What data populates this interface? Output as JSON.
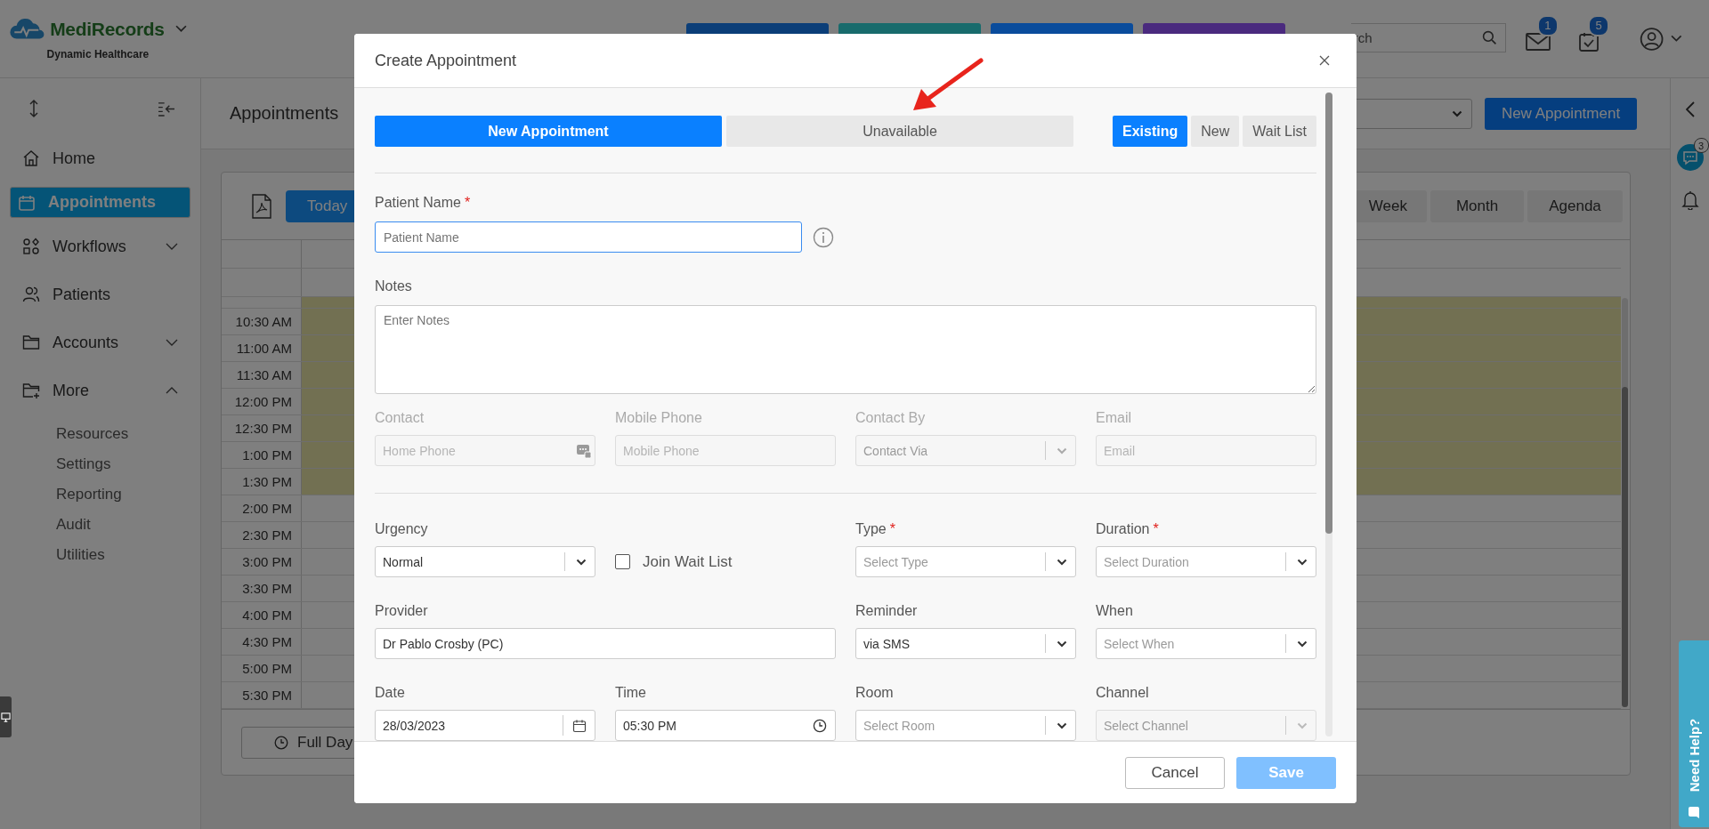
{
  "header": {
    "brand": "MediRecords",
    "tagline": "Dynamic Healthcare",
    "quick_buttons": [
      {
        "color": "#0b3e78"
      },
      {
        "color": "#186b6c"
      },
      {
        "color": "#0a4c9c"
      },
      {
        "color": "#4a2a7e"
      }
    ],
    "search": {
      "placeholder": "rch"
    },
    "notifications": [
      {
        "kind": "mail",
        "badge": "1"
      },
      {
        "kind": "tasks",
        "badge": "5"
      }
    ]
  },
  "sidebar": {
    "items": [
      {
        "kind": "home",
        "label": "Home",
        "selected": false
      },
      {
        "kind": "calendar",
        "label": "Appointments",
        "selected": true
      },
      {
        "kind": "workflow",
        "label": "Workflows",
        "selected": false,
        "expanded": false
      },
      {
        "kind": "patients",
        "label": "Patients",
        "selected": false
      },
      {
        "kind": "folder",
        "label": "Accounts",
        "selected": false,
        "expanded": false
      },
      {
        "kind": "folder-plus",
        "label": "More",
        "selected": false,
        "expanded": true,
        "children": [
          {
            "label": "Resources"
          },
          {
            "label": "Settings"
          },
          {
            "label": "Reporting"
          },
          {
            "label": "Audit"
          },
          {
            "label": "Utilities"
          }
        ]
      }
    ]
  },
  "page": {
    "title": "Appointments",
    "new_button": "New Appointment"
  },
  "calendar": {
    "today": "Today",
    "views": [
      {
        "label": "Week",
        "selected": false
      },
      {
        "label": "Month",
        "selected": false
      },
      {
        "label": "Agenda",
        "selected": false
      }
    ],
    "times": [
      {
        "unavailable": true
      },
      {
        "label": "10:30 AM",
        "unavailable": true
      },
      {
        "label": "11:00 AM",
        "unavailable": true
      },
      {
        "label": "11:30 AM",
        "unavailable": true
      },
      {
        "label": "12:00 PM",
        "unavailable": true
      },
      {
        "label": "12:30 PM",
        "unavailable": true
      },
      {
        "label": "1:00 PM",
        "unavailable": true
      },
      {
        "label": "1:30 PM",
        "unavailable": true
      },
      {
        "label": "2:00 PM",
        "unavailable": false
      },
      {
        "label": "2:30 PM",
        "unavailable": false
      },
      {
        "label": "3:00 PM",
        "unavailable": false
      },
      {
        "label": "3:30 PM",
        "unavailable": false
      },
      {
        "label": "4:00 PM",
        "unavailable": false
      },
      {
        "label": "4:30 PM",
        "unavailable": false
      },
      {
        "label": "5:00 PM",
        "unavailable": false
      },
      {
        "label": "5:30 PM",
        "unavailable": false
      }
    ],
    "full_day": "Full Day"
  },
  "right_rail": {
    "chat_badge": "3",
    "help_label": "Need Help?"
  },
  "modal": {
    "title": "Create Appointment",
    "modes": [
      {
        "label": "New Appointment",
        "selected": true
      },
      {
        "label": "Unavailable",
        "selected": false
      }
    ],
    "patient_types": [
      {
        "label": "Existing",
        "selected": true
      },
      {
        "label": "New",
        "selected": false
      },
      {
        "label": "Wait List",
        "selected": false
      }
    ],
    "patient_name": {
      "label": "Patient Name",
      "required_mark": "*",
      "placeholder": "Patient Name"
    },
    "notes": {
      "label": "Notes",
      "placeholder": "Enter Notes"
    },
    "contact_row": {
      "disabled": true,
      "fields": [
        {
          "kind": "phone",
          "label": "Contact",
          "placeholder": "Home Phone",
          "disabled": true
        },
        {
          "kind": "text",
          "label": "Mobile Phone",
          "placeholder": "Mobile Phone",
          "disabled": true
        },
        {
          "kind": "select",
          "label": "Contact By",
          "placeholder": "Contact Via",
          "disabled": true
        },
        {
          "kind": "text",
          "label": "Email",
          "placeholder": "Email",
          "disabled": true
        }
      ]
    },
    "detail_rows": [
      [
        {
          "kind": "select",
          "label": "Urgency",
          "value": "Normal",
          "disabled": false
        },
        {
          "kind": "checkbox",
          "label": "Join Wait List",
          "checked": false
        },
        {
          "kind": "select",
          "label": "Type",
          "required_mark": "*",
          "placeholder": "Select Type",
          "disabled": false
        },
        {
          "kind": "select",
          "label": "Duration",
          "required_mark": "*",
          "placeholder": "Select Duration",
          "disabled": false
        }
      ],
      [
        {
          "kind": "text",
          "label": "Provider",
          "value": "Dr Pablo Crosby (PC)",
          "disabled": false
        },
        {
          "kind": "select",
          "label": "Reminder",
          "value": "via SMS",
          "disabled": false
        },
        {
          "kind": "select",
          "label": "When",
          "placeholder": "Select When",
          "disabled": false
        }
      ],
      [
        {
          "kind": "date",
          "label": "Date",
          "value": "28/03/2023",
          "disabled": false
        },
        {
          "kind": "time",
          "label": "Time",
          "value": "05:30 PM",
          "disabled": false
        },
        {
          "kind": "select",
          "label": "Room",
          "placeholder": "Select Room",
          "disabled": false
        },
        {
          "kind": "select",
          "label": "Channel",
          "placeholder": "Select Channel",
          "disabled": true
        }
      ]
    ],
    "cancel": "Cancel",
    "save": {
      "label": "Save",
      "disabled": true
    }
  }
}
